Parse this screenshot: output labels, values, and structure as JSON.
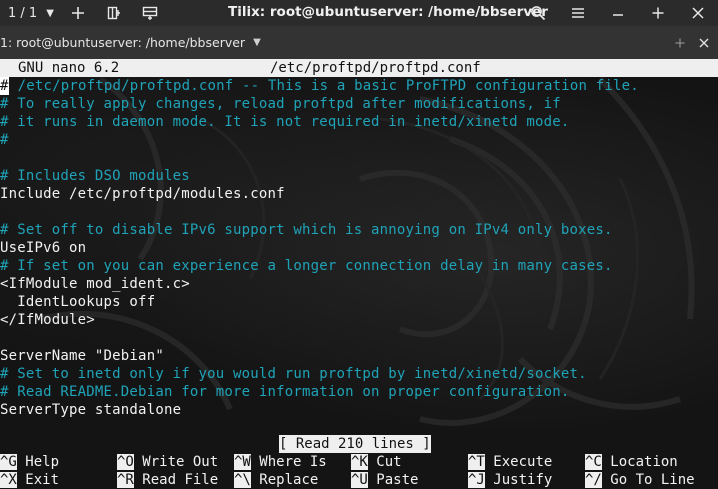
{
  "titlebar": {
    "session": "1 / 1",
    "title": "Tilix: root@ubuntuserver: /home/bbserver",
    "icons": {
      "session_dropdown": "chevron-down-icon",
      "add_terminal": "plus-icon",
      "add_right": "split-right-icon",
      "add_down": "split-down-icon",
      "search": "search-icon",
      "menu": "hamburger-icon",
      "minimize": "minimize-icon",
      "maximize": "plus-icon",
      "close": "close-icon"
    }
  },
  "terminal_header": {
    "title": "1: root@ubuntuserver: /home/bbserver",
    "icons": {
      "dropdown": "chevron-down-icon",
      "maximize": "plus-icon",
      "close": "close-icon"
    }
  },
  "nano": {
    "app": "GNU nano 6.2",
    "filename": "/etc/proftpd/proftpd.conf",
    "cursor_char": "#",
    "lines": [
      {
        "text": " /etc/proftpd/proftpd.conf -- This is a basic ProFTPD configuration file.",
        "prefix": "#",
        "type": "comment"
      },
      {
        "text": "# To really apply changes, reload proftpd after modifications, if",
        "type": "comment"
      },
      {
        "text": "# it runs in daemon mode. It is not required in inetd/xinetd mode.",
        "type": "comment"
      },
      {
        "text": "#",
        "type": "comment"
      },
      {
        "text": "",
        "type": "plain"
      },
      {
        "text": "# Includes DSO modules",
        "type": "comment"
      },
      {
        "text": "Include /etc/proftpd/modules.conf",
        "type": "plain"
      },
      {
        "text": "",
        "type": "plain"
      },
      {
        "text": "# Set off to disable IPv6 support which is annoying on IPv4 only boxes.",
        "type": "comment"
      },
      {
        "text": "UseIPv6 on",
        "type": "plain"
      },
      {
        "text": "# If set on you can experience a longer connection delay in many cases.",
        "type": "comment"
      },
      {
        "text": "<IfModule mod_ident.c>",
        "type": "plain"
      },
      {
        "text": "  IdentLookups off",
        "type": "plain"
      },
      {
        "text": "</IfModule>",
        "type": "plain"
      },
      {
        "text": "",
        "type": "plain"
      },
      {
        "text": "ServerName \"Debian\"",
        "type": "plain"
      },
      {
        "text": "# Set to inetd only if you would run proftpd by inetd/xinetd/socket.",
        "type": "comment"
      },
      {
        "text": "# Read README.Debian for more information on proper configuration.",
        "type": "comment"
      },
      {
        "text": "ServerType standalone",
        "type": "plain"
      }
    ],
    "status": "[ Read 210 lines ]",
    "shortcuts_row1": [
      {
        "key": "^G",
        "label": "Help"
      },
      {
        "key": "^O",
        "label": "Write Out"
      },
      {
        "key": "^W",
        "label": "Where Is"
      },
      {
        "key": "^K",
        "label": "Cut"
      },
      {
        "key": "^T",
        "label": "Execute"
      },
      {
        "key": "^C",
        "label": "Location"
      }
    ],
    "shortcuts_row2": [
      {
        "key": "^X",
        "label": "Exit"
      },
      {
        "key": "^R",
        "label": "Read File"
      },
      {
        "key": "^\\",
        "label": "Replace"
      },
      {
        "key": "^U",
        "label": "Paste"
      },
      {
        "key": "^J",
        "label": "Justify"
      },
      {
        "key": "^/",
        "label": "Go To Line"
      }
    ]
  },
  "colors": {
    "comment": "#1fa3b8",
    "text": "#f2f2f2",
    "header_bg": "#efefef",
    "titlebar_bg": "#2b2b2b",
    "termhead_bg": "#333333"
  }
}
